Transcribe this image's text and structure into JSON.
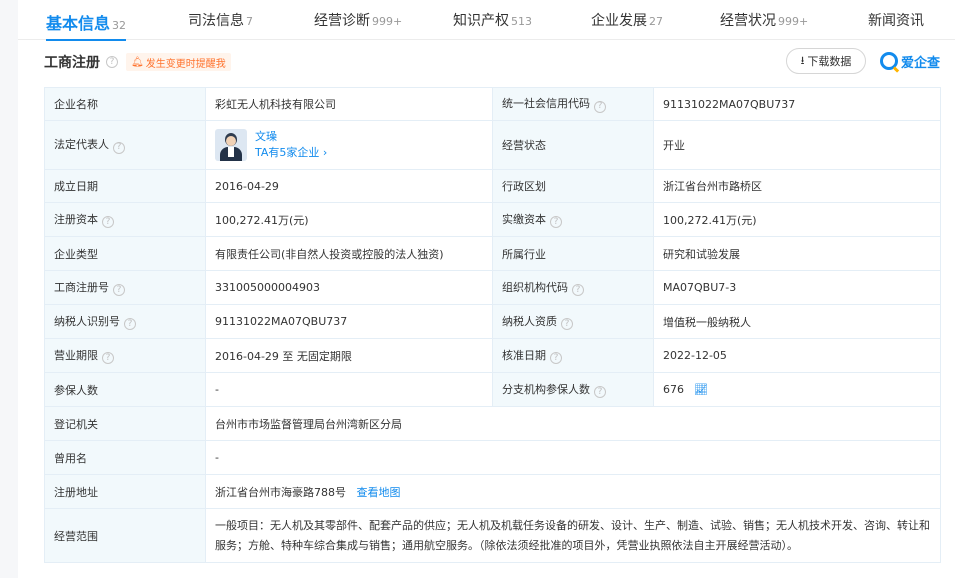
{
  "tabs": [
    {
      "label": "基本信息",
      "count": "32",
      "active": true
    },
    {
      "label": "司法信息",
      "count": "7"
    },
    {
      "label": "经营诊断",
      "count": "999+"
    },
    {
      "label": "知识产权",
      "count": "513"
    },
    {
      "label": "企业发展",
      "count": "27"
    },
    {
      "label": "经营状况",
      "count": "999+"
    },
    {
      "label": "新闻资讯",
      "count": ""
    }
  ],
  "section": {
    "title": "工商注册",
    "notify_label": "发生变更时提醒我",
    "download_label": "下载数据",
    "brand": "爱企查"
  },
  "fields": {
    "company_name": {
      "label": "企业名称",
      "value": "彩虹无人机科技有限公司"
    },
    "credit_code": {
      "label": "统一社会信用代码",
      "value": "91131022MA07QBU737"
    },
    "legal_rep": {
      "label": "法定代表人",
      "name": "文璪",
      "sub": "TA有5家企业"
    },
    "status": {
      "label": "经营状态",
      "value": "开业"
    },
    "established": {
      "label": "成立日期",
      "value": "2016-04-29"
    },
    "region": {
      "label": "行政区划",
      "value": "浙江省台州市路桥区"
    },
    "reg_capital": {
      "label": "注册资本",
      "value": "100,272.41万(元)"
    },
    "paid_capital": {
      "label": "实缴资本",
      "value": "100,272.41万(元)"
    },
    "company_type": {
      "label": "企业类型",
      "value": "有限责任公司(非自然人投资或控股的法人独资)"
    },
    "industry": {
      "label": "所属行业",
      "value": "研究和试验发展"
    },
    "reg_no": {
      "label": "工商注册号",
      "value": "331005000004903"
    },
    "org_code": {
      "label": "组织机构代码",
      "value": "MA07QBU7-3"
    },
    "taxpayer_id": {
      "label": "纳税人识别号",
      "value": "91131022MA07QBU737"
    },
    "taxpayer_qual": {
      "label": "纳税人资质",
      "value": "增值税一般纳税人"
    },
    "term": {
      "label": "营业期限",
      "value": "2016-04-29 至 无固定期限"
    },
    "approval_date": {
      "label": "核准日期",
      "value": "2022-12-05"
    },
    "insured": {
      "label": "参保人数",
      "value": "-"
    },
    "branch_insured": {
      "label": "分支机构参保人数",
      "value": "676"
    },
    "authority": {
      "label": "登记机关",
      "value": "台州市市场监督管理局台州湾新区分局"
    },
    "former_name": {
      "label": "曾用名",
      "value": "-"
    },
    "address": {
      "label": "注册地址",
      "value": "浙江省台州市海豪路788号",
      "map_link": "查看地图"
    },
    "scope": {
      "label": "经营范围",
      "value": "一般项目：无人机及其零部件、配套产品的供应；无人机及机载任务设备的研发、设计、生产、制造、试验、销售；无人机技术开发、咨询、转让和服务；方舱、特种车综合集成与销售；通用航空服务。（除依法须经批准的项目外，凭营业执照依法自主开展经营活动）。"
    }
  }
}
